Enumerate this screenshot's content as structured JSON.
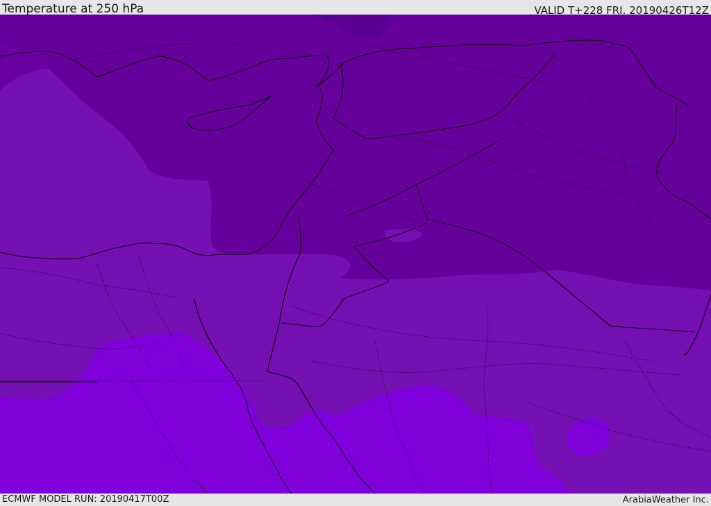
{
  "header": {
    "title": "Temperature at 250 hPa",
    "valid_time": "VALID T+228 FRI. 20190426T12Z"
  },
  "footer": {
    "model_run": "ECMWF MODEL RUN: 20190417T00Z",
    "credit": "ArabiaWeather Inc."
  },
  "map": {
    "field": "temperature",
    "pressure_level_hpa": 250,
    "shading_colors": {
      "coldest": "#66009a",
      "cold": "#6a00a0",
      "mid": "#7510b2",
      "warm": "#8000dc",
      "darkest_patch": "#5a0090"
    },
    "coastline_color": "#000000",
    "border_style": "dotted"
  }
}
